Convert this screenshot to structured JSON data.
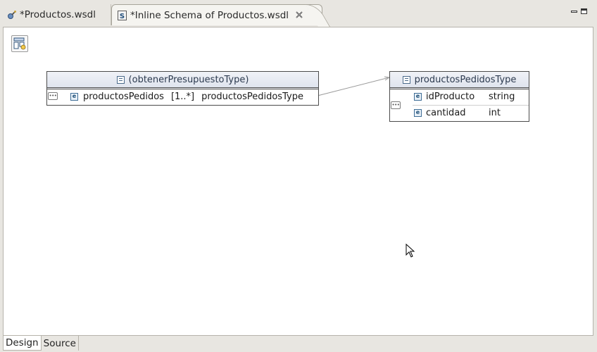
{
  "tabs": [
    {
      "label": "*Productos.wsdl",
      "icon": "wsdl-file-icon",
      "active": false
    },
    {
      "label": "*Inline Schema of Productos.wsdl",
      "icon": "schema-file-icon",
      "active": true
    }
  ],
  "canvas": {
    "toolbar_icon": "show-palette-icon",
    "complex_types": [
      {
        "name": "(obtenerPresupuestoType)",
        "elements": [
          {
            "name": "productosPedidos",
            "multiplicity": "[1..*]",
            "type": "productosPedidosType"
          }
        ]
      },
      {
        "name": "productosPedidosType",
        "elements": [
          {
            "name": "idProducto",
            "type": "string"
          },
          {
            "name": "cantidad",
            "type": "int"
          }
        ]
      }
    ]
  },
  "bottom_tabs": [
    {
      "label": "Design",
      "active": true
    },
    {
      "label": "Source",
      "active": false
    }
  ]
}
